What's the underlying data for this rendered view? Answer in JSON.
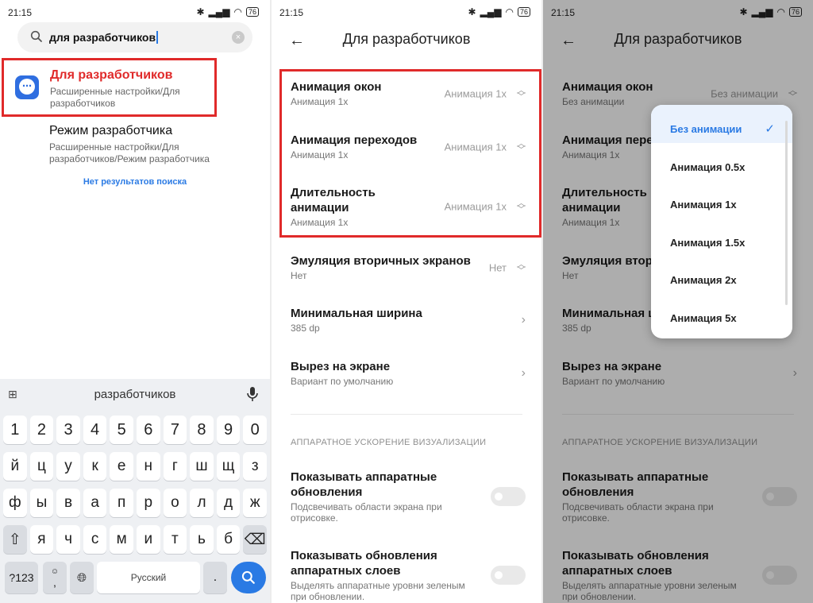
{
  "status": {
    "time": "21:15",
    "battery": "76"
  },
  "search": {
    "query": "для разработчиков",
    "results": [
      {
        "title": "Для разработчиков",
        "path": "Расширенные настройки/Для разработчиков"
      },
      {
        "title": "Режим разработчика",
        "path": "Расширенные настройки/Для разработчиков/Режим разработчика"
      }
    ],
    "no_results": "Нет результатов поиска"
  },
  "keyboard": {
    "suggestion": "разработчиков",
    "row_numbers": [
      "1",
      "2",
      "3",
      "4",
      "5",
      "6",
      "7",
      "8",
      "9",
      "0"
    ],
    "row1": [
      "й",
      "ц",
      "у",
      "к",
      "е",
      "н",
      "г",
      "ш",
      "щ",
      "з"
    ],
    "row2": [
      "ф",
      "ы",
      "в",
      "а",
      "п",
      "р",
      "о",
      "л",
      "д",
      "ж"
    ],
    "row3": [
      "я",
      "ч",
      "с",
      "м",
      "и",
      "т",
      "ь",
      "б"
    ],
    "sym_label": "?123",
    "space_label": "Русский",
    "comma": ",",
    "period": "."
  },
  "settings": {
    "title": "Для разработчиков",
    "window_anim": {
      "label": "Анимация окон",
      "sub": "Анимация 1x",
      "value": "Анимация 1x"
    },
    "transition_anim": {
      "label": "Анимация переходов",
      "sub": "Анимация 1x",
      "value": "Анимация 1x"
    },
    "duration_anim": {
      "label": "Длительность анимации",
      "sub": "Анимация 1x",
      "value": "Анимация 1x"
    },
    "secondary_displays": {
      "label": "Эмуляция вторичных экранов",
      "sub": "Нет",
      "value": "Нет"
    },
    "min_width": {
      "label": "Минимальная ширина",
      "sub": "385 dp"
    },
    "cutout": {
      "label": "Вырез на экране",
      "sub": "Вариант по умолчанию"
    },
    "hw_section": "АППАРАТНОЕ УСКОРЕНИЕ ВИЗУАЛИЗАЦИИ",
    "hw_updates": {
      "label": "Показывать аппаратные обновления",
      "sub": "Подсвечивать области экрана при отрисовке."
    },
    "hw_layers": {
      "label": "Показывать обновления аппаратных слоев",
      "sub": "Выделять аппаратные уровни зеленым при обновлении."
    }
  },
  "screen3": {
    "window_anim_value": "Без анимации",
    "window_anim_label": "Анимация окон",
    "window_anim_sub": "Без анимации",
    "transition_label_trunc": "Анимация пере",
    "secondary_label_trunc": "Эмуляция втор",
    "min_width_label_trunc": "Минимальная ш",
    "options": [
      "Без анимации",
      "Анимация 0.5x",
      "Анимация 1x",
      "Анимация 1.5x",
      "Анимация 2x",
      "Анимация 5x"
    ]
  },
  "colors": {
    "highlight": "#e02a2a",
    "accent": "#2a7ae4"
  }
}
